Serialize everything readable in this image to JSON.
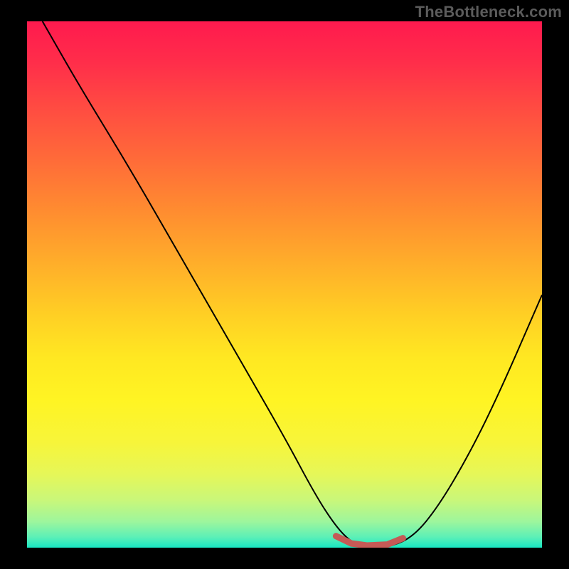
{
  "watermark": "TheBottleneck.com",
  "chart_data": {
    "type": "line",
    "title": "",
    "xlabel": "",
    "ylabel": "",
    "xlim": [
      0,
      100
    ],
    "ylim": [
      0,
      100
    ],
    "grid": false,
    "series": [
      {
        "name": "bottleneck-curve",
        "color": "#000000",
        "x": [
          3,
          10,
          20,
          30,
          40,
          50,
          56,
          60,
          63,
          66,
          70,
          75,
          80,
          86,
          92,
          100
        ],
        "y": [
          100,
          88,
          72,
          55,
          38,
          21,
          10,
          4,
          1,
          0,
          0,
          2,
          8,
          18,
          30,
          48
        ]
      }
    ],
    "highlight": {
      "name": "optimal-range",
      "color": "#c55a56",
      "x": [
        60,
        63,
        66,
        70,
        73
      ],
      "y": [
        2.2,
        0.8,
        0.4,
        0.6,
        1.8
      ]
    },
    "background_gradient": {
      "top": "#ff1a4e",
      "mid": "#ffe822",
      "bottom": "#18e6c2"
    }
  }
}
